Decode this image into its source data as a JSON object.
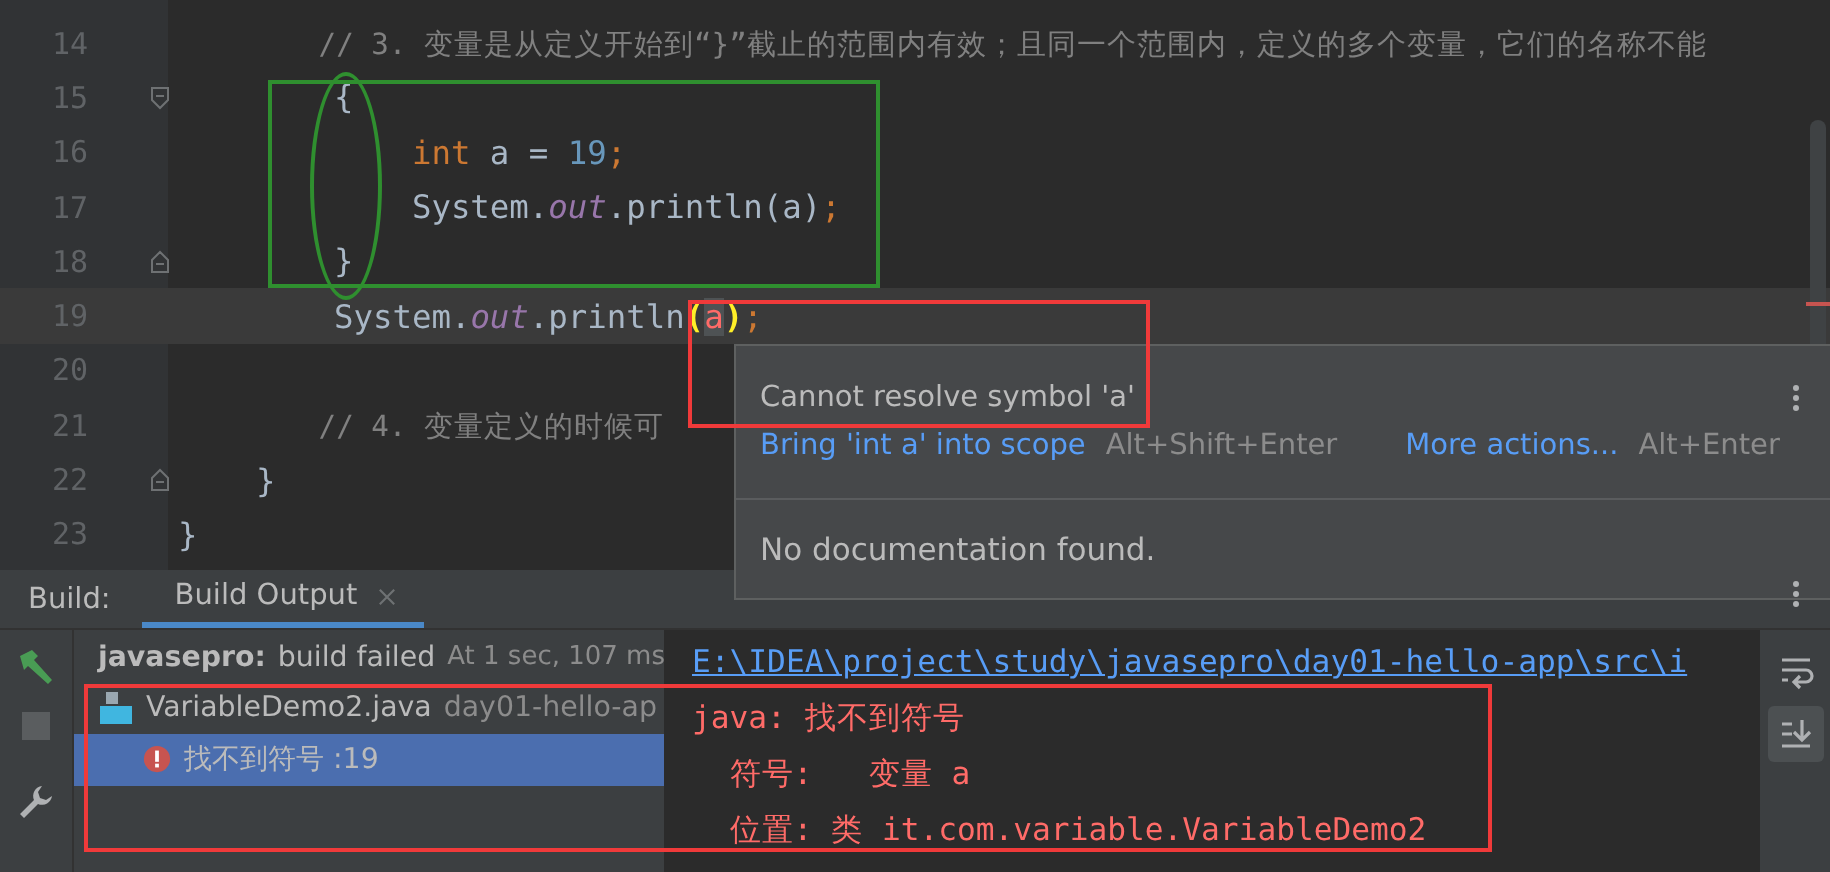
{
  "editor": {
    "lines": [
      {
        "number": "14",
        "current": false,
        "kind": "code",
        "tokens": [
          {
            "kind": "comment",
            "text": "        // 3. 变量是从定义开始到“}”截止的范围内有效；且同一个范围内，定义的多个变量，它们的名称不能"
          }
        ]
      },
      {
        "number": "15",
        "current": false,
        "kind": "opener",
        "tokens": [
          {
            "kind": "plain",
            "text": "        {"
          }
        ]
      },
      {
        "number": "16",
        "current": false,
        "kind": "code",
        "tokens": [
          {
            "kind": "keyword",
            "text": "            int"
          },
          {
            "kind": "plain",
            "text": " a = "
          },
          {
            "kind": "number",
            "text": "19"
          },
          {
            "kind": "punct",
            "text": ";"
          }
        ]
      },
      {
        "number": "17",
        "current": false,
        "kind": "code",
        "tokens": [
          {
            "kind": "plain",
            "text": "            System."
          },
          {
            "kind": "field",
            "text": "out"
          },
          {
            "kind": "plain",
            "text": ".println(a)"
          },
          {
            "kind": "punct",
            "text": ";"
          }
        ]
      },
      {
        "number": "18",
        "current": false,
        "kind": "closer",
        "tokens": [
          {
            "kind": "plain",
            "text": "        }"
          }
        ]
      },
      {
        "number": "19",
        "current": true,
        "kind": "code",
        "tokens": [
          {
            "kind": "plain",
            "text": "        System."
          },
          {
            "kind": "field",
            "text": "out"
          },
          {
            "kind": "plain",
            "text": ".println"
          },
          {
            "kind": "match",
            "text": "("
          },
          {
            "kind": "error",
            "text": "a"
          },
          {
            "kind": "match",
            "text": ")"
          },
          {
            "kind": "punct",
            "text": ";"
          }
        ]
      },
      {
        "number": "20",
        "current": false,
        "kind": "code"
      },
      {
        "number": "21",
        "current": false,
        "kind": "code",
        "tokens": [
          {
            "kind": "comment",
            "text": "        // 4. 变量定义的时候可"
          }
        ]
      },
      {
        "number": "22",
        "current": false,
        "kind": "closer",
        "tokens": [
          {
            "kind": "plain",
            "text": "    }"
          }
        ]
      },
      {
        "number": "23",
        "current": false,
        "kind": "code",
        "tokens": [
          {
            "kind": "plain",
            "text": "}"
          }
        ]
      }
    ]
  },
  "popup": {
    "message": "Cannot resolve symbol 'a'",
    "actions": [
      {
        "label": "Bring 'int a' into scope",
        "shortcut": "Alt+Shift+Enter"
      },
      {
        "label": "More actions...",
        "shortcut": "Alt+Enter"
      }
    ],
    "documentation": "No documentation found."
  },
  "build": {
    "label": "Build:",
    "tabs": [
      {
        "label": "Build Output",
        "selected": true
      }
    ],
    "summary": {
      "project": "javasepro:",
      "status": "build failed",
      "time": "At 1 sec, 107 ms"
    },
    "tree": [
      {
        "label": "VariableDemo2.java",
        "detail": "day01-hello-ap",
        "selected": false,
        "children": [
          {
            "label": "找不到符号 :19",
            "selected": true
          }
        ]
      }
    ],
    "console": {
      "path": "E:\\IDEA\\project\\study\\javasepro\\day01-hello-app\\src\\i",
      "lines": [
        "java: 找不到符号",
        "  符号:   变量 a",
        "  位置: 类 it.com.variable.VariableDemo2"
      ]
    }
  }
}
